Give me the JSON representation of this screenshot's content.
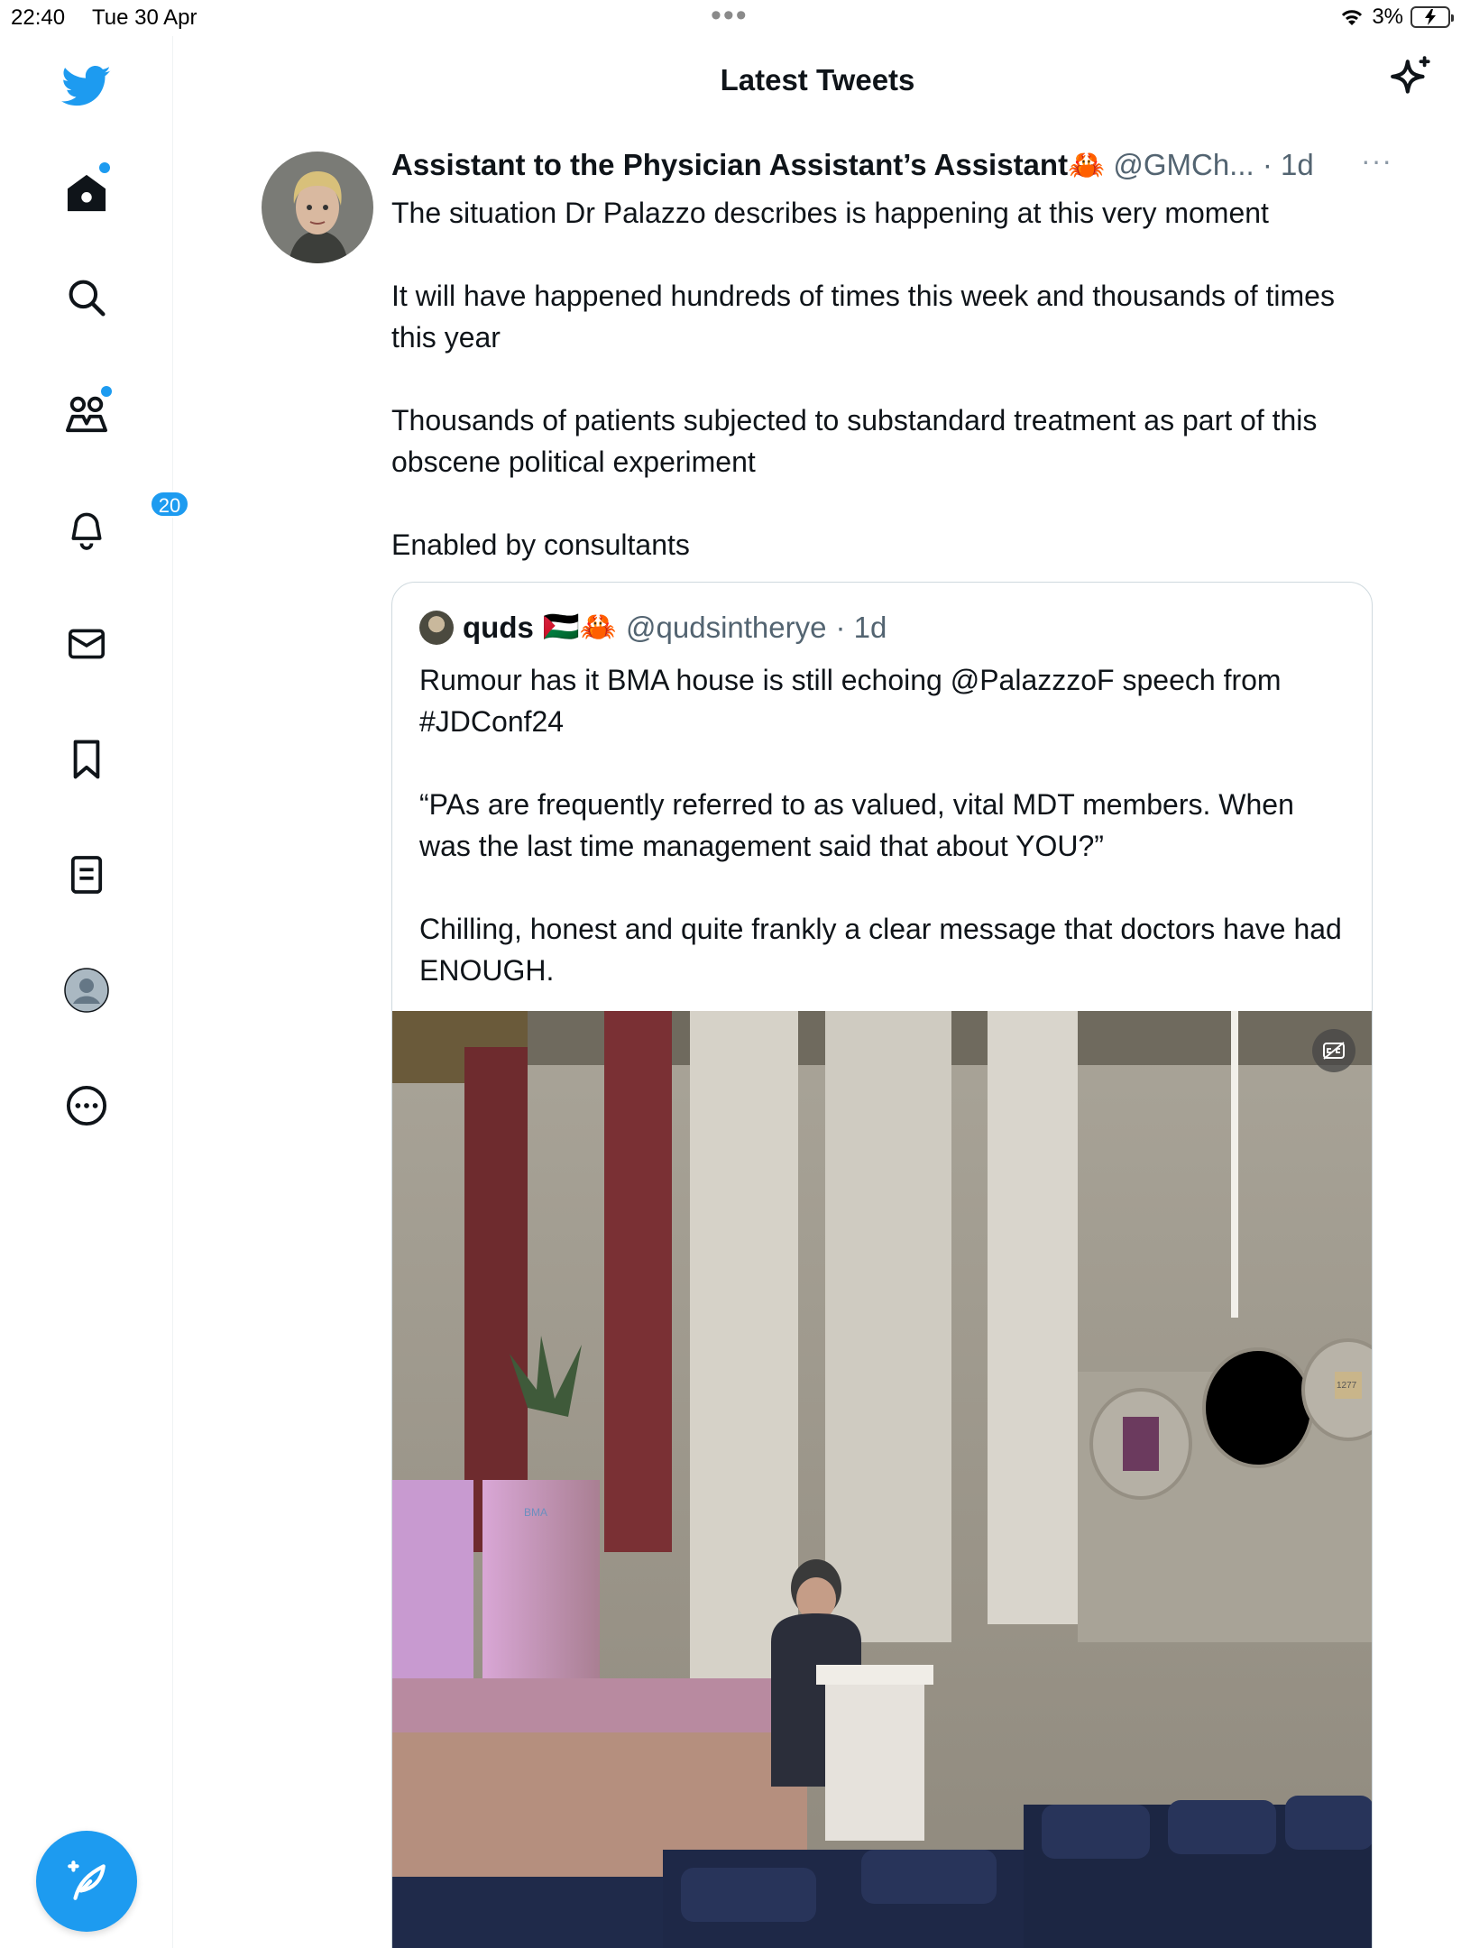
{
  "status_bar": {
    "time": "22:40",
    "date": "Tue 30 Apr",
    "battery": "3%"
  },
  "header": {
    "title": "Latest Tweets"
  },
  "sidebar": {
    "items": [
      {
        "icon": "home-icon"
      },
      {
        "icon": "search-icon"
      },
      {
        "icon": "communities-icon"
      },
      {
        "icon": "notifications-icon",
        "badge": "20"
      },
      {
        "icon": "messages-icon"
      },
      {
        "icon": "bookmarks-icon"
      },
      {
        "icon": "lists-icon"
      },
      {
        "icon": "profile-icon"
      },
      {
        "icon": "more-icon"
      }
    ],
    "compose_icon": "compose-icon"
  },
  "tweet": {
    "name": "Assistant to the Physician Assistant’s Assistant🦀",
    "handle": "@GMCh...",
    "time": "· 1d",
    "more": "···",
    "paragraphs": [
      "The situation Dr Palazzo describes is happening at this very moment",
      "It will have happened hundreds of times this week and thousands of times this year",
      "Thousands of patients subjected to substandard treatment as part of this obscene political experiment",
      "Enabled by consultants"
    ]
  },
  "quote": {
    "name": "quds",
    "flags": "🇵🇸🦀",
    "handle": "@qudsintherye",
    "time": "· 1d",
    "paragraphs": [
      "Rumour has it BMA house is still echoing @PalazzzoF speech from #JDConf24",
      "“PAs are frequently referred to as valued, vital MDT members. When was the last time management said that about YOU?”",
      "Chilling, honest and quite frankly a clear message that doctors have had ENOUGH."
    ],
    "media": {
      "lectern_logo": "BMA",
      "crest_text": "1277"
    }
  },
  "colors": {
    "accent": "#1d9bf0",
    "text": "#0f1419",
    "muted": "#536471",
    "border": "#cfd9de"
  }
}
